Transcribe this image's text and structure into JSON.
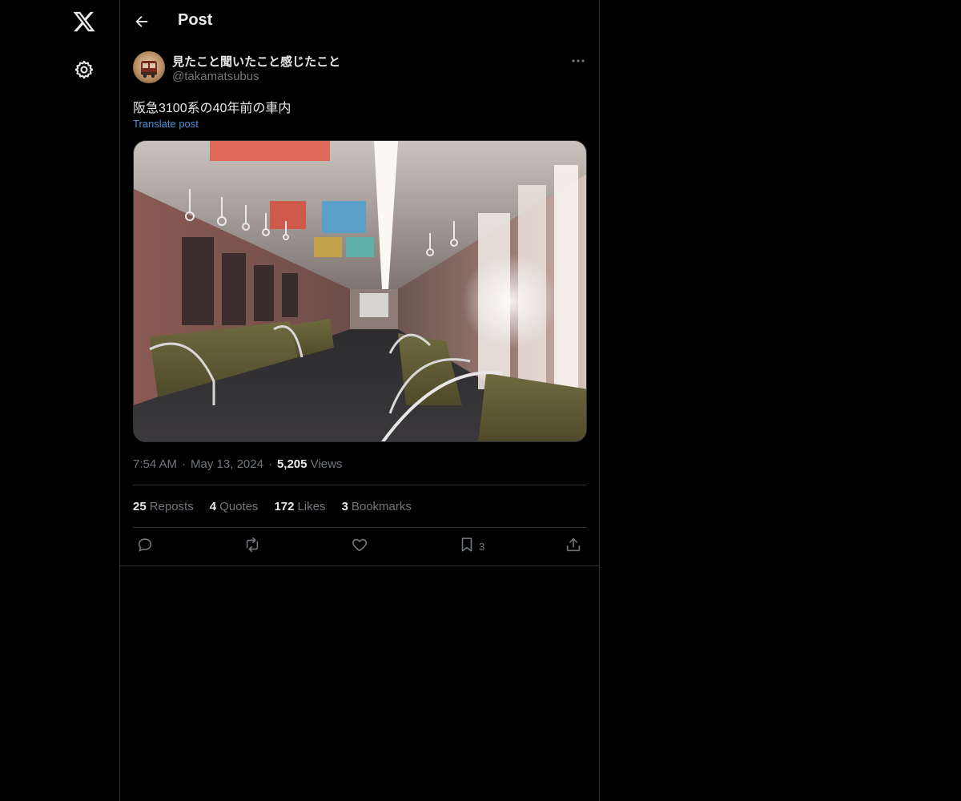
{
  "header": {
    "title": "Post",
    "back_icon": "back-arrow-icon"
  },
  "nav": {
    "logo_icon": "x-logo-icon",
    "settings_icon": "gear-icon"
  },
  "post": {
    "author": {
      "display_name": "見たこと聞いたこと感じたこと",
      "handle": "@takamatsubus"
    },
    "text": "阪急3100系の40年前の車内",
    "translate_label": "Translate post",
    "time": "7:54 AM",
    "date": "May 13, 2024",
    "views_count": "5,205",
    "views_label": "Views",
    "stats": {
      "reposts_count": "25",
      "reposts_label": "Reposts",
      "quotes_count": "4",
      "quotes_label": "Quotes",
      "likes_count": "172",
      "likes_label": "Likes",
      "bookmarks_count": "3",
      "bookmarks_label": "Bookmarks"
    },
    "actions": {
      "bookmark_count": "3"
    }
  },
  "colors": {
    "background": "#000000",
    "text_primary": "#e7e9ea",
    "text_secondary": "#71767b",
    "link": "#4c8fd6",
    "border": "#2f3336"
  }
}
